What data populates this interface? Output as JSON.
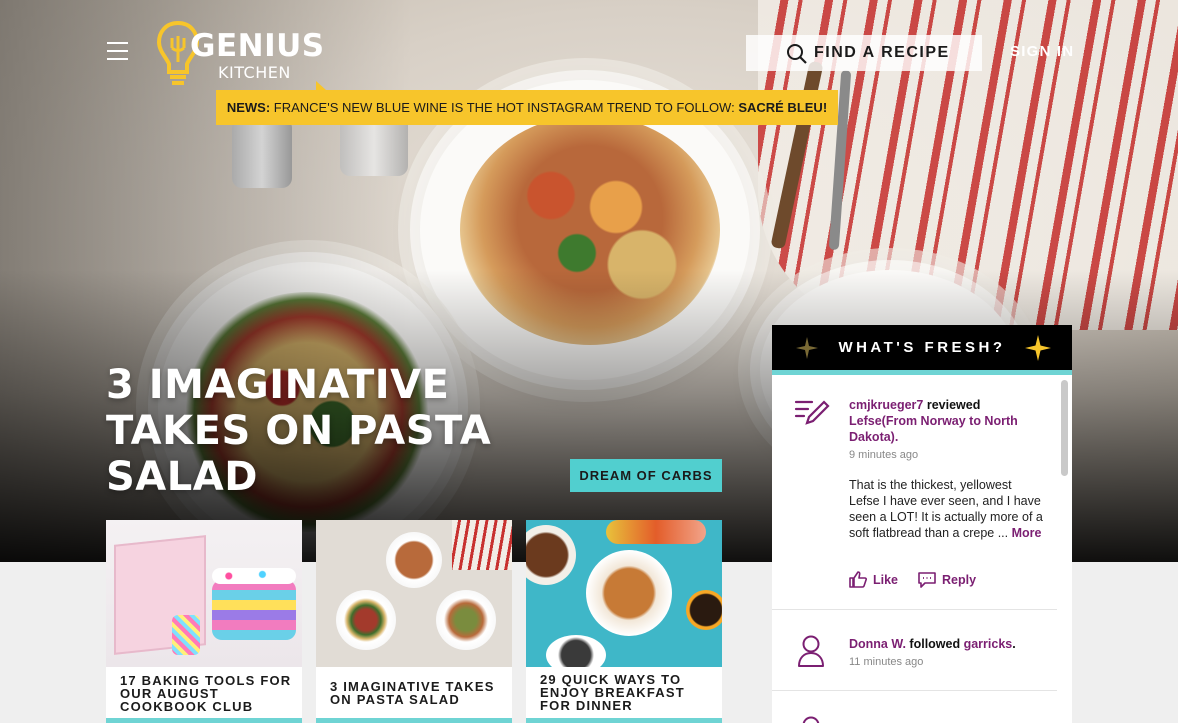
{
  "colors": {
    "accent_yellow": "#f7c52b",
    "accent_teal": "#51cfcf",
    "brand_purple": "#7b1f72",
    "panel_header": "#000000"
  },
  "header": {
    "logo_main": "GENIUS",
    "logo_sub": "KITCHEN",
    "search_label": "FIND A RECIPE",
    "sign_in": "SIGN IN",
    "news_prefix": "NEWS:",
    "news_text": " FRANCE'S NEW BLUE WINE IS THE HOT INSTAGRAM TREND TO FOLLOW: ",
    "news_suffix": "SACRÉ BLEU!"
  },
  "hero": {
    "headline": "3 IMAGINATIVE TAKES ON PASTA SALAD",
    "tag": "DREAM OF CARBS"
  },
  "cards": [
    {
      "title": "17 BAKING TOOLS FOR OUR AUGUST COOKBOOK CLUB"
    },
    {
      "title": "3 IMAGINATIVE TAKES ON PASTA SALAD"
    },
    {
      "title": "29 QUICK WAYS TO ENJOY BREAKFAST FOR DINNER"
    }
  ],
  "whats_fresh": {
    "title": "WHAT'S FRESH?",
    "items": [
      {
        "icon": "review-pencil-icon",
        "user": "cmjkrueger7",
        "action": " reviewed ",
        "target": "Lefse(From Norway to North Dakota)",
        "target_end": ".",
        "time": "9 minutes ago",
        "body": "That is the thickest, yellowest Lefse I have ever seen, and I have seen a LOT! It is actually more of a soft flatbread than a crepe ...",
        "more": "More",
        "like": "Like",
        "reply": "Reply"
      },
      {
        "icon": "person-icon",
        "user": "Donna W.",
        "action": " followed ",
        "target": "garricks",
        "target_end": ".",
        "time": "11 minutes ago"
      }
    ]
  }
}
